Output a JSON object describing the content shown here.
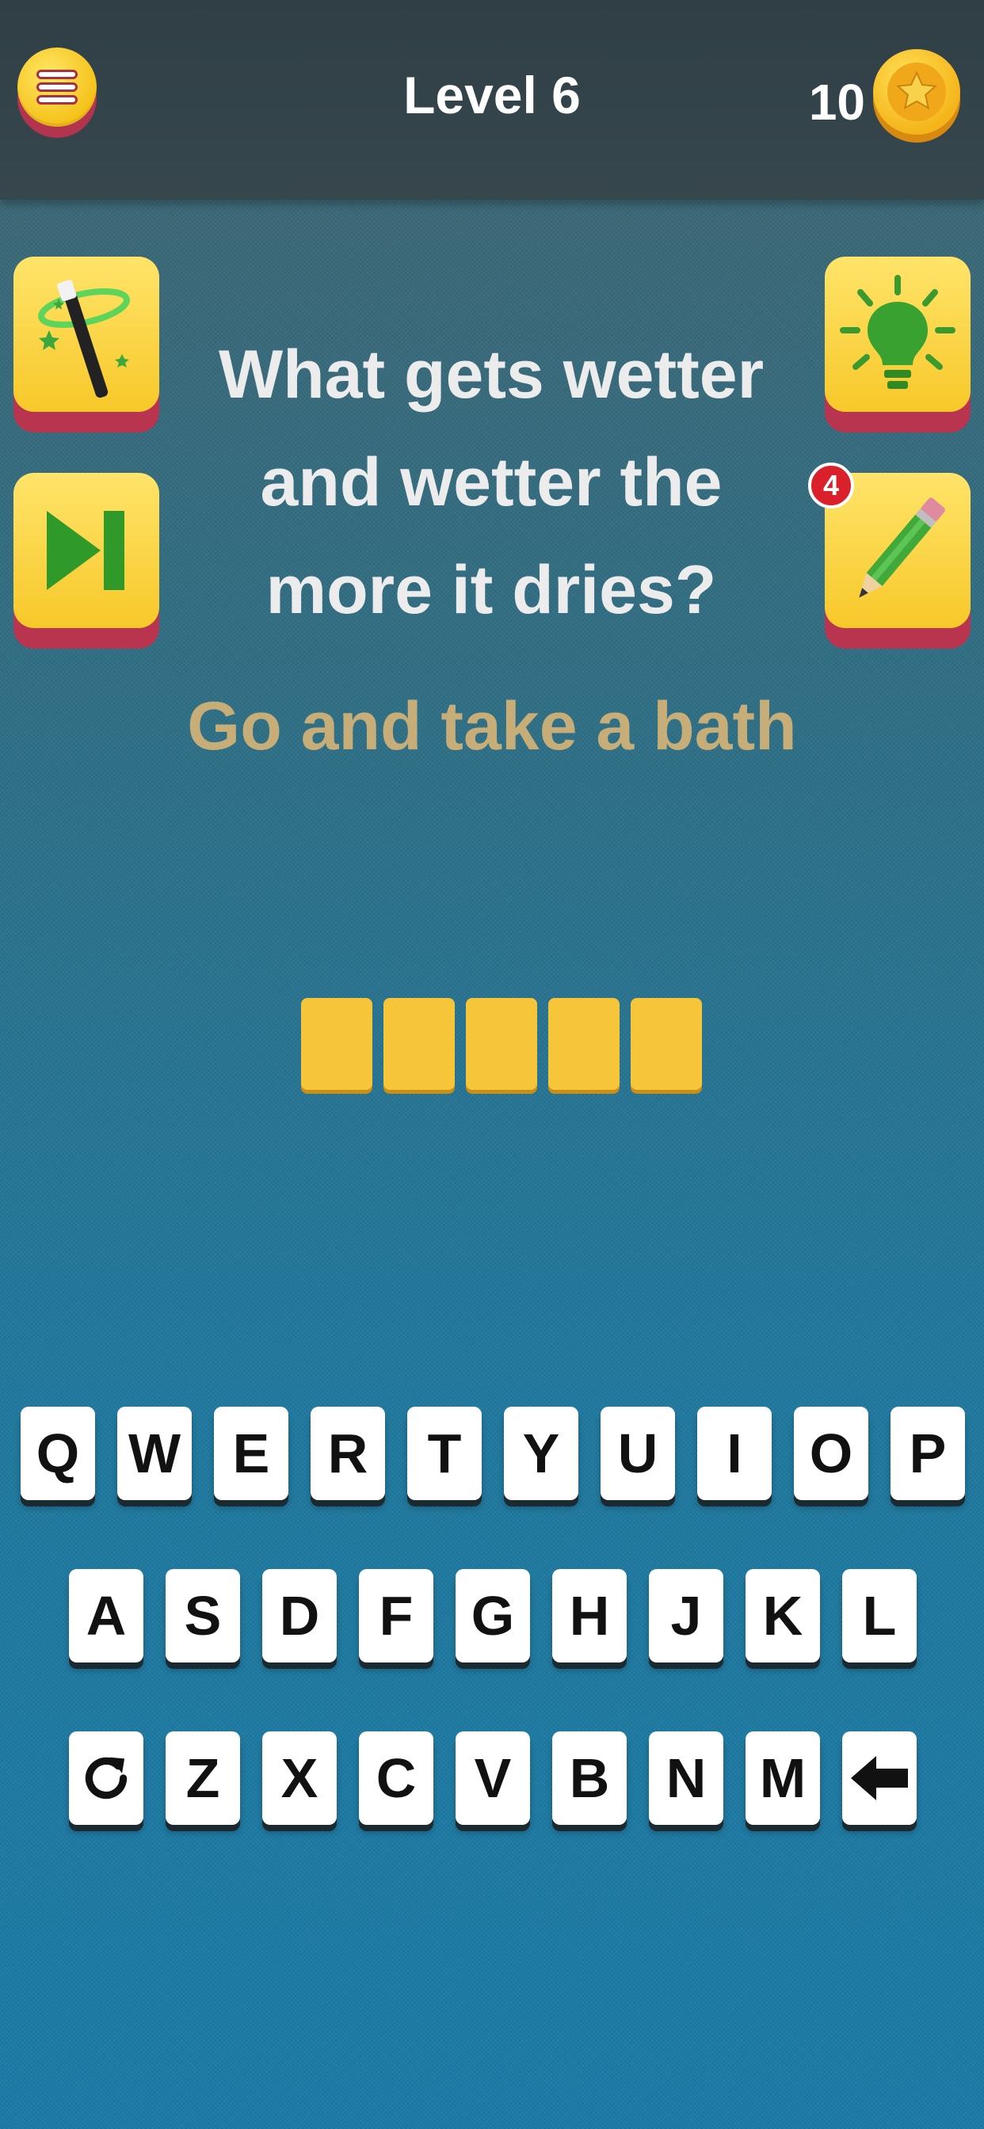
{
  "header": {
    "level_title": "Level 6",
    "coins": "10"
  },
  "question": {
    "text": "What gets wetter and wetter the more it dries?"
  },
  "hint": {
    "text": "Go and take a bath"
  },
  "answer": {
    "slots": 5
  },
  "powerups": {
    "pencil_badge": "4"
  },
  "keyboard": {
    "row1": [
      "Q",
      "W",
      "E",
      "R",
      "T",
      "Y",
      "U",
      "I",
      "O",
      "P"
    ],
    "row2": [
      "A",
      "S",
      "D",
      "F",
      "G",
      "H",
      "J",
      "K",
      "L"
    ],
    "row3": [
      "Z",
      "X",
      "C",
      "V",
      "B",
      "N",
      "M"
    ]
  },
  "colors": {
    "button_yellow": "#f7c829",
    "button_base": "#b8344f",
    "hint": "#c7ad78",
    "slot": "#f7c53a"
  }
}
